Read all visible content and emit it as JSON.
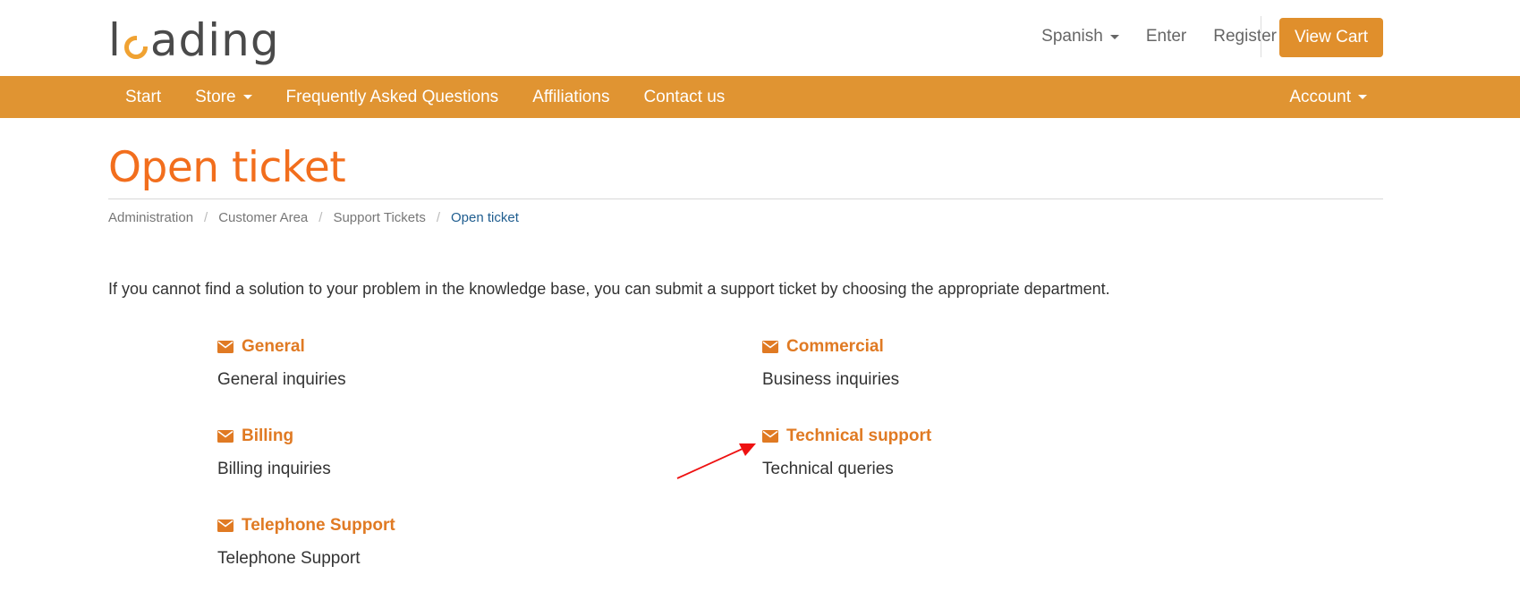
{
  "header": {
    "logo_text_before": "l",
    "logo_text_after": "ading",
    "language_label": "Spanish",
    "enter_label": "Enter",
    "register_label": "Register",
    "cart_button_label": "View Cart"
  },
  "nav": {
    "items": [
      {
        "label": "Start"
      },
      {
        "label": "Store"
      },
      {
        "label": "Frequently Asked Questions"
      },
      {
        "label": "Affiliations"
      },
      {
        "label": "Contact us"
      }
    ],
    "account_label": "Account"
  },
  "page": {
    "title": "Open ticket",
    "breadcrumb": [
      {
        "label": "Administration"
      },
      {
        "label": "Customer Area"
      },
      {
        "label": "Support Tickets"
      },
      {
        "label": "Open ticket"
      }
    ],
    "breadcrumb_separator": "/",
    "intro": "If you cannot find a solution to your problem in the knowledge base, you can submit a support ticket by choosing the appropriate department."
  },
  "departments": [
    {
      "name": "General",
      "description": "General inquiries"
    },
    {
      "name": "Commercial",
      "description": "Business inquiries"
    },
    {
      "name": "Billing",
      "description": "Billing inquiries"
    },
    {
      "name": "Technical support",
      "description": "Technical queries"
    },
    {
      "name": "Telephone Support",
      "description": "Telephone Support"
    }
  ],
  "icons": {
    "department_icon": "envelope-icon",
    "dropdown_icon": "caret-down-icon"
  },
  "colors": {
    "brand_orange": "#e09432",
    "title_orange": "#f26e1d",
    "link_orange": "#e07a23",
    "breadcrumb_active": "#1f5d8f",
    "annotation_arrow": "#ee1111"
  }
}
